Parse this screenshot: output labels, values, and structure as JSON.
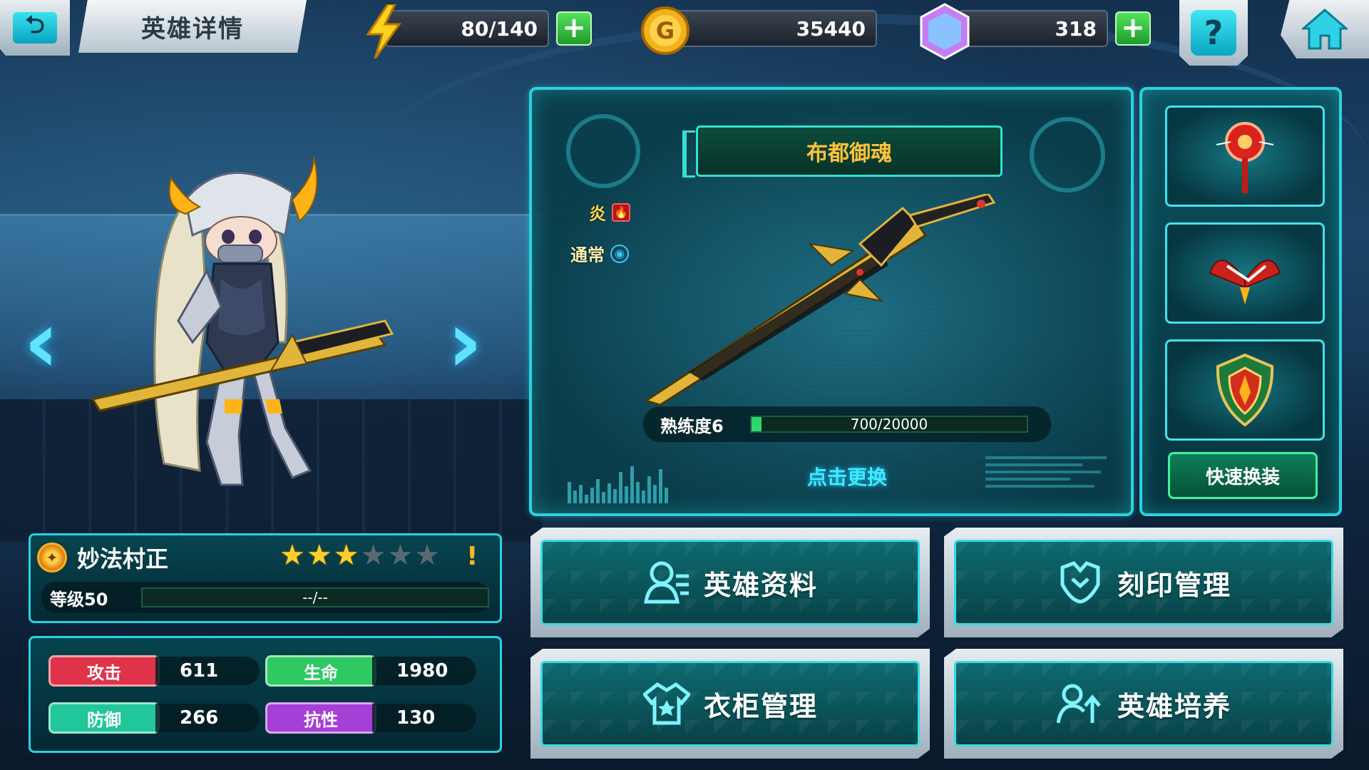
{
  "header": {
    "title": "英雄详情",
    "back_icon": "back-arrow-icon",
    "energy": {
      "value": "80/140",
      "icon": "lightning-icon"
    },
    "gold": {
      "value": "35440",
      "icon": "gold-coin-icon",
      "coin_letter": "G"
    },
    "gems": {
      "value": "318",
      "icon": "gem-icon"
    },
    "help_label": "?",
    "home_icon": "home-icon"
  },
  "weapon": {
    "name": "布都御魂",
    "element": "炎",
    "attack_type": "通常",
    "proficiency_label": "熟练度6",
    "proficiency_value": "700/20000",
    "proficiency_progress": 0.035,
    "change_label": "点击更换"
  },
  "equipment": {
    "slots": [
      {
        "icon": "red-scepter-icon"
      },
      {
        "icon": "phoenix-wings-icon"
      },
      {
        "icon": "crest-shield-icon"
      }
    ],
    "quick_equip_label": "快速换装"
  },
  "hero": {
    "name": "妙法村正",
    "stars_filled": 3,
    "stars_total": 6,
    "warning": "!",
    "level_label": "等级50",
    "exp_value": "--/--"
  },
  "stats": [
    {
      "label": "攻击",
      "value": "611",
      "color": "#e0334a"
    },
    {
      "label": "生命",
      "value": "1980",
      "color": "#2fc964"
    },
    {
      "label": "防御",
      "value": "266",
      "color": "#21c79a"
    },
    {
      "label": "抗性",
      "value": "130",
      "color": "#a53fd6"
    }
  ],
  "menu": [
    {
      "label": "英雄资料",
      "icon": "hero-profile-icon"
    },
    {
      "label": "刻印管理",
      "icon": "imprint-icon"
    },
    {
      "label": "衣柜管理",
      "icon": "wardrobe-icon"
    },
    {
      "label": "英雄培养",
      "icon": "hero-upgrade-icon"
    }
  ],
  "colors": {
    "accent_cyan": "#2ad3df",
    "weapon_name": "#ffc238",
    "plus_green": "#2fbf38",
    "star_gold": "#ffd02a"
  }
}
